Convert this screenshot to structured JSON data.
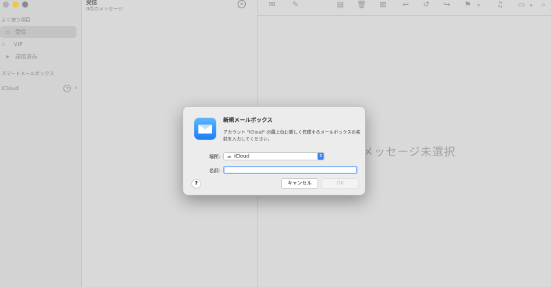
{
  "window": {
    "traffic_lights": {
      "close": "#b0b0b0",
      "minimize": "#f5c542",
      "zoom": "#8a8a8a"
    }
  },
  "sidebar": {
    "favorites_label": "よく使う項目",
    "items": [
      {
        "icon": "tray-icon",
        "label": "受信"
      },
      {
        "icon": "star-icon",
        "label": "VIP"
      },
      {
        "icon": "paperplane-icon",
        "label": "送信済み"
      }
    ],
    "smart_label": "スマートメールボックス",
    "account": "iCloud"
  },
  "message_list": {
    "title": "受信",
    "count": "0件のメッセージ"
  },
  "reading_pane": {
    "empty_text": "メッセージ未選択"
  },
  "dialog": {
    "title": "新規メールボックス",
    "message": "アカウント \"iCloud\" の最上位に新しく作成するメールボックスの名前を入力してください。",
    "location_label": "場所:",
    "location_value": "iCloud",
    "name_label": "名前:",
    "name_value": "",
    "help_label": "?",
    "cancel_label": "キャンセル",
    "ok_label": "OK",
    "accent": "#3b82f6"
  }
}
